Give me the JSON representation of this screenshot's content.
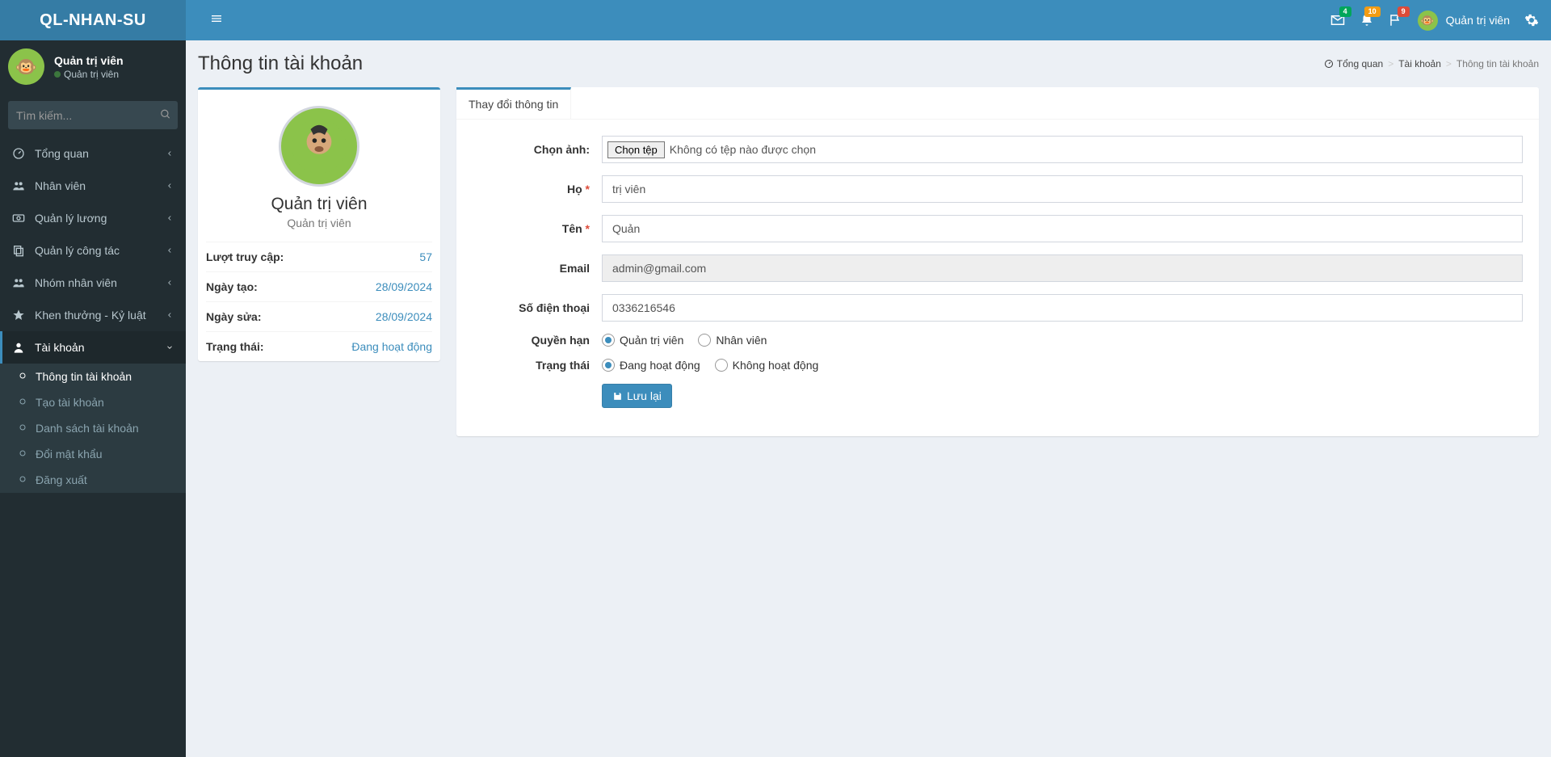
{
  "brand": "QL-NHAN-SU",
  "header": {
    "badges": {
      "mail": "4",
      "bell": "10",
      "flag": "9"
    },
    "user_name": "Quản trị viên"
  },
  "sidebar_user": {
    "name": "Quản trị viên",
    "role": "Quản trị viên"
  },
  "search": {
    "placeholder": "Tìm kiếm..."
  },
  "sidebar": {
    "items": [
      {
        "label": "Tổng quan"
      },
      {
        "label": "Nhân viên"
      },
      {
        "label": "Quản lý lương"
      },
      {
        "label": "Quản lý công tác"
      },
      {
        "label": "Nhóm nhân viên"
      },
      {
        "label": "Khen thưởng - Kỷ luật"
      },
      {
        "label": "Tài khoản"
      }
    ],
    "account_sub": [
      {
        "label": "Thông tin tài khoản"
      },
      {
        "label": "Tạo tài khoản"
      },
      {
        "label": "Danh sách tài khoản"
      },
      {
        "label": "Đổi mật khẩu"
      },
      {
        "label": "Đăng xuất"
      }
    ]
  },
  "page": {
    "title": "Thông tin tài khoản",
    "breadcrumb": {
      "home": "Tổng quan",
      "mid": "Tài khoản",
      "current": "Thông tin tài khoản"
    }
  },
  "profile": {
    "name": "Quản trị viên",
    "role": "Quản trị viên",
    "rows": {
      "visits_label": "Lượt truy cập:",
      "visits_val": "57",
      "created_label": "Ngày tạo:",
      "created_val": "28/09/2024",
      "updated_label": "Ngày sửa:",
      "updated_val": "28/09/2024",
      "status_label": "Trạng thái:",
      "status_val": "Đang hoạt động"
    }
  },
  "tab": {
    "label": "Thay đổi thông tin"
  },
  "form": {
    "choose_image_label": "Chọn ảnh:",
    "choose_file_btn": "Chọn tệp",
    "no_file": "Không có tệp nào được chọn",
    "lastname_label": "Họ",
    "lastname_val": "trị viên",
    "firstname_label": "Tên",
    "firstname_val": "Quản",
    "email_label": "Email",
    "email_val": "admin@gmail.com",
    "phone_label": "Số điện thoại",
    "phone_val": "0336216546",
    "role_label": "Quyền hạn",
    "role_opt1": "Quản trị viên",
    "role_opt2": "Nhân viên",
    "status_label": "Trạng thái",
    "status_opt1": "Đang hoạt động",
    "status_opt2": "Không hoạt động",
    "save_btn": "Lưu lại"
  }
}
